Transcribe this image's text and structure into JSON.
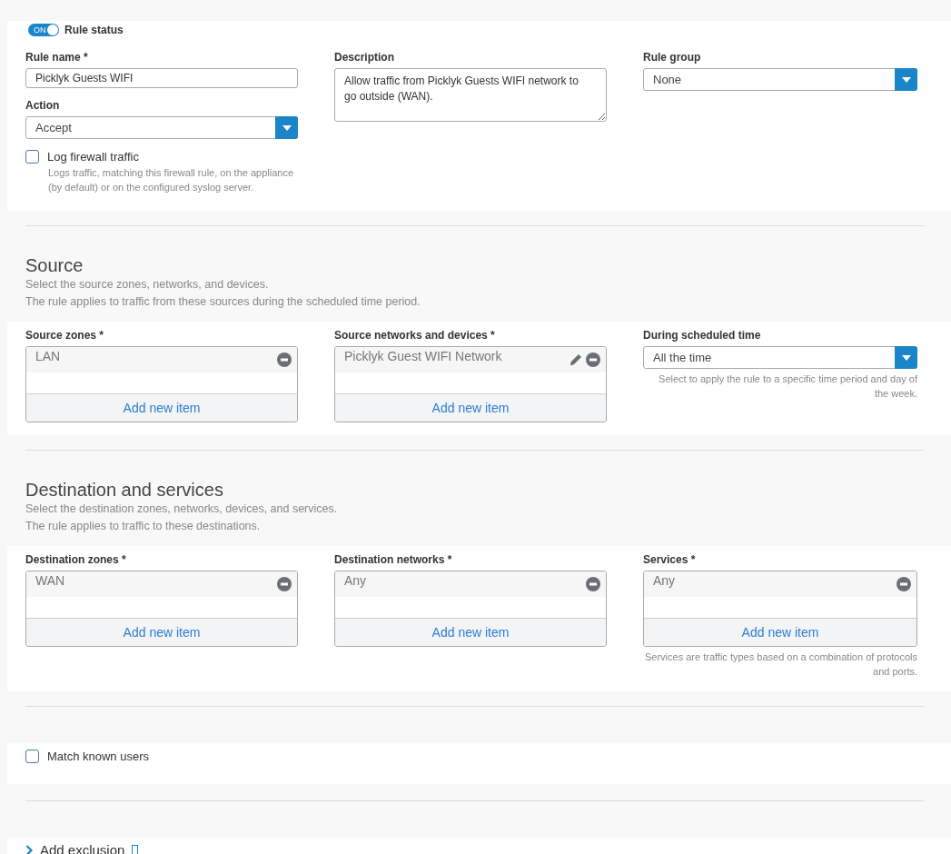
{
  "rule_status": {
    "label": "Rule status",
    "toggle_text": "ON",
    "on": true
  },
  "general": {
    "columns": [
      [
        {
          "kind": "text",
          "label": "Rule name *",
          "value": "Picklyk Guests WIFI"
        },
        {
          "kind": "select",
          "label": "Action",
          "value": "Accept"
        },
        {
          "kind": "checkbox",
          "label": "Log firewall traffic",
          "checked": false,
          "help": "Logs traffic, matching this firewall rule, on the appliance (by default) or on the configured syslog server."
        }
      ],
      [
        {
          "kind": "textarea",
          "label": "Description",
          "value": "Allow traffic from Picklyk Guests WIFI network to go outside (WAN)."
        }
      ],
      [
        {
          "kind": "select",
          "label": "Rule group",
          "value": "None"
        }
      ]
    ]
  },
  "sections": [
    {
      "title": "Source",
      "lines": [
        "Select the source zones, networks, and devices.",
        "The rule applies to traffic from these sources during the scheduled time period."
      ],
      "columns": [
        [
          {
            "kind": "list",
            "label": "Source zones *",
            "items": [
              {
                "text": "LAN",
                "editable": false
              }
            ],
            "add": "Add new item"
          }
        ],
        [
          {
            "kind": "list",
            "label": "Source networks and devices *",
            "items": [
              {
                "text": "Picklyk Guest WIFI Network",
                "editable": true
              }
            ],
            "add": "Add new item"
          }
        ],
        [
          {
            "kind": "select",
            "label": "During scheduled time",
            "value": "All the time",
            "help": "Select to apply the rule to a specific time period and day of the week."
          }
        ]
      ]
    },
    {
      "title": "Destination and services",
      "lines": [
        "Select the destination zones, networks, devices, and services.",
        "The rule applies to traffic to these destinations."
      ],
      "columns": [
        [
          {
            "kind": "list",
            "label": "Destination zones *",
            "items": [
              {
                "text": "WAN",
                "editable": false
              }
            ],
            "add": "Add new item"
          }
        ],
        [
          {
            "kind": "list",
            "label": "Destination networks *",
            "items": [
              {
                "text": "Any",
                "editable": false
              }
            ],
            "add": "Add new item"
          }
        ],
        [
          {
            "kind": "list",
            "label": "Services *",
            "items": [
              {
                "text": "Any",
                "editable": false
              }
            ],
            "add": "Add new item",
            "help": "Services are traffic types based on a combination of protocols and ports."
          }
        ]
      ]
    }
  ],
  "match_known_users": {
    "label": "Match known users",
    "checked": false
  },
  "exclusion": {
    "label": "Add exclusion",
    "expanded": false
  }
}
